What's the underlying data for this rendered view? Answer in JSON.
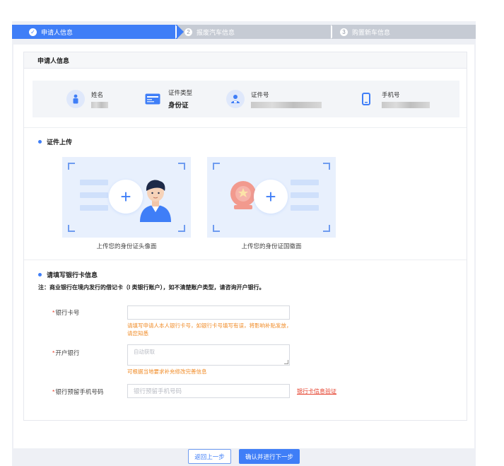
{
  "steps": [
    {
      "num": "✓",
      "label": "申请人信息",
      "active": true
    },
    {
      "num": "2",
      "label": "报废汽车信息",
      "active": false
    },
    {
      "num": "3",
      "label": "购置新车信息",
      "active": false
    }
  ],
  "panel": {
    "title": "申请人信息",
    "info": {
      "name_label": "姓名",
      "idtype_label": "证件类型",
      "idtype_value": "身份证",
      "idno_label": "证件号",
      "phone_label": "手机号"
    },
    "upload_section": {
      "title": "证件上传",
      "front_caption": "上传您的身份证头像面",
      "back_caption": "上传您的身份证国徽面",
      "plus": "+"
    },
    "bank_section": {
      "title": "请填写银行卡信息",
      "note": "注：商业银行在境内发行的借记卡（I 类银行账户），如不清楚账户类型，请咨询开户银行。",
      "card_no_label": "银行卡号",
      "card_no_hint": "请填写申请人本人银行卡号，如银行卡号填写有误，将影响补贴发放，请您知悉",
      "bank_label": "开户银行",
      "bank_placeholder": "自动获取",
      "bank_hint": "可根据当地要求补充修改完善信息",
      "phone_label": "银行预留手机号码",
      "phone_placeholder": "银行预留手机号码",
      "verify_link": "银行卡信息验证",
      "required_mark": "*"
    }
  },
  "footer": {
    "back_label": "返回上一步",
    "next_label": "确认并进行下一步"
  },
  "colors": {
    "primary": "#3f7ef7",
    "inactive_step": "#c6cbd4",
    "hint": "#f08a24",
    "required": "#e5422e"
  }
}
